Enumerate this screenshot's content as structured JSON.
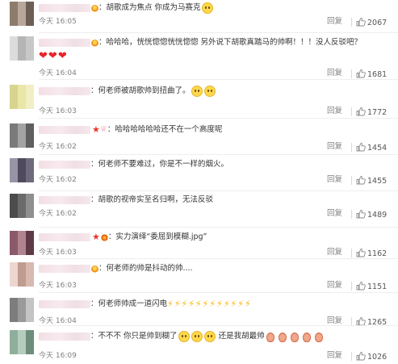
{
  "comments": [
    {
      "avatar_colors": [
        "#8d7b6c",
        "#b8a79a",
        "#6d5e53"
      ],
      "badge": true,
      "star": false,
      "crown": false,
      "text": "胡歌成为焦点 你成为马赛克",
      "emoji": [
        "cat"
      ],
      "time": "今天 16:05",
      "reply": "回复",
      "likes": "2067"
    },
    {
      "avatar_colors": [
        "#c8c8c8",
        "#dcdcdc",
        "#b5b5b5"
      ],
      "badge": true,
      "star": false,
      "crown": false,
      "text": "哈哈哈，恍恍惚惚恍恍惚惚   另外说下胡歌真踏马的帅啊！！！没人反驳吧？",
      "emoji": [
        "heart",
        "heart",
        "heart"
      ],
      "time": "今天 16:04",
      "reply": "回复",
      "likes": "1681"
    },
    {
      "avatar_colors": [
        "#e9e6a8",
        "#f2efc4",
        "#d8d48f"
      ],
      "badge": false,
      "star": false,
      "crown": false,
      "text": "何老师被胡歌帅到扭曲了。",
      "emoji": [
        "cat",
        "cat"
      ],
      "time": "今天 16:03",
      "reply": "回复",
      "likes": "1772"
    },
    {
      "avatar_colors": [
        "#7a7a7a",
        "#a3a3a3",
        "#5f5f5f"
      ],
      "badge": false,
      "star": true,
      "crown": true,
      "text": "哈哈哈哈哈哈还不在一个高度呢",
      "emoji": [],
      "time": "今天 16:02",
      "reply": "回复",
      "likes": "1454"
    },
    {
      "avatar_colors": [
        "#6e6a7e",
        "#9894a6",
        "#4f4b5c"
      ],
      "badge": false,
      "star": false,
      "crown": false,
      "text": "何老师不要难过，你是不一样的烟火。",
      "emoji": [],
      "time": "今天 16:02",
      "reply": "回复",
      "likes": "1455"
    },
    {
      "avatar_colors": [
        "#6b6b6b",
        "#8f8f8f",
        "#4c4c4c"
      ],
      "badge": false,
      "star": false,
      "crown": false,
      "text": "胡歌的视帝实至名归啊，无法反驳",
      "emoji": [],
      "time": "今天 16:02",
      "reply": "回复",
      "likes": "1489"
    },
    {
      "avatar_colors": [
        "#8a5a6a",
        "#b0838f",
        "#5e3a47"
      ],
      "badge": true,
      "star": true,
      "crown": false,
      "text": "实力演绎“委屈到模糊.jpg”",
      "emoji": [],
      "time": "今天 16:03",
      "reply": "回复",
      "likes": "1162"
    },
    {
      "avatar_colors": [
        "#d7b9b0",
        "#ecd7d0",
        "#c09b90"
      ],
      "badge": true,
      "star": false,
      "crown": false,
      "text": "何老师的帅是抖动的帅....",
      "emoji": [],
      "time": "今天 16:03",
      "reply": "回复",
      "likes": "1151"
    },
    {
      "avatar_colors": [
        "#9a9a9a",
        "#c4c4c4",
        "#7d7d7d"
      ],
      "badge": false,
      "star": false,
      "crown": false,
      "text": "何老师帅成一道闪电",
      "emoji": [
        "bolts"
      ],
      "time": "今天 16:04",
      "reply": "回复",
      "likes": "1265"
    },
    {
      "avatar_colors": [
        "#8fae9b",
        "#b4cdbd",
        "#6d8d7a"
      ],
      "badge": false,
      "star": false,
      "crown": false,
      "text": "不不不 你只是帅到糊了",
      "emoji": [
        "cat",
        "cat",
        "cat"
      ],
      "text2": "还是我胡最帅",
      "emoji2": [
        "hand",
        "hand",
        "hand",
        "hand",
        "hand"
      ],
      "time": "今天 16:09",
      "reply": "回复",
      "likes": "1026"
    }
  ]
}
